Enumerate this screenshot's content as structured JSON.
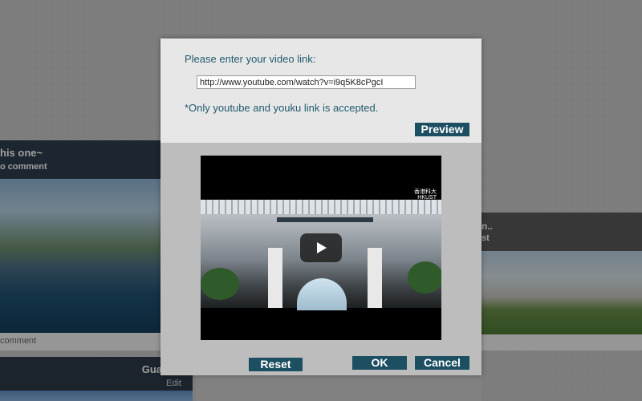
{
  "background": {
    "left_card": {
      "title": "his one~",
      "subtitle": "o comment",
      "footer": "comment"
    },
    "right_card": {
      "title": "n..",
      "subtitle": "st"
    },
    "bottom_card": {
      "title": "Gua",
      "edit_label": "Edit"
    }
  },
  "modal": {
    "prompt": "Please enter your video link:",
    "url_value": "http://www.youtube.com/watch?v=i9q5K8cPgcI",
    "note": "*Only youtube and youku link is accepted.",
    "preview_button": "Preview",
    "video": {
      "logo_line1": "香港科大",
      "logo_line2": "HKUST"
    },
    "reset_button": "Reset",
    "ok_button": "OK",
    "cancel_button": "Cancel"
  },
  "colors": {
    "button_bg": "#1d4f62",
    "label_text": "#1f5a6e",
    "modal_top_bg": "#e7e7e7",
    "modal_bottom_bg": "#bdbdbd"
  },
  "icons": {
    "play": "play-icon"
  }
}
